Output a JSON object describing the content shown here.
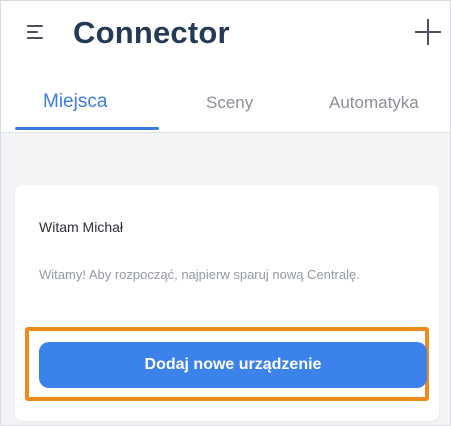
{
  "header": {
    "title": "Connector",
    "menu_icon": "hamburger-menu-icon",
    "add_icon": "plus-icon"
  },
  "tabs": [
    {
      "label": "Miejsca",
      "active": true
    },
    {
      "label": "Sceny",
      "active": false
    },
    {
      "label": "Automatyka",
      "active": false
    }
  ],
  "card": {
    "greeting": "Witam Michał",
    "message": "Witamy! Aby rozpocząć, najpierw sparuj nową Centralę.",
    "button_label": "Dodaj nowe urządzenie"
  },
  "colors": {
    "accent": "#3b7de3",
    "button": "#3b82ea",
    "title": "#243a57",
    "highlight": "#ef8a1f"
  }
}
